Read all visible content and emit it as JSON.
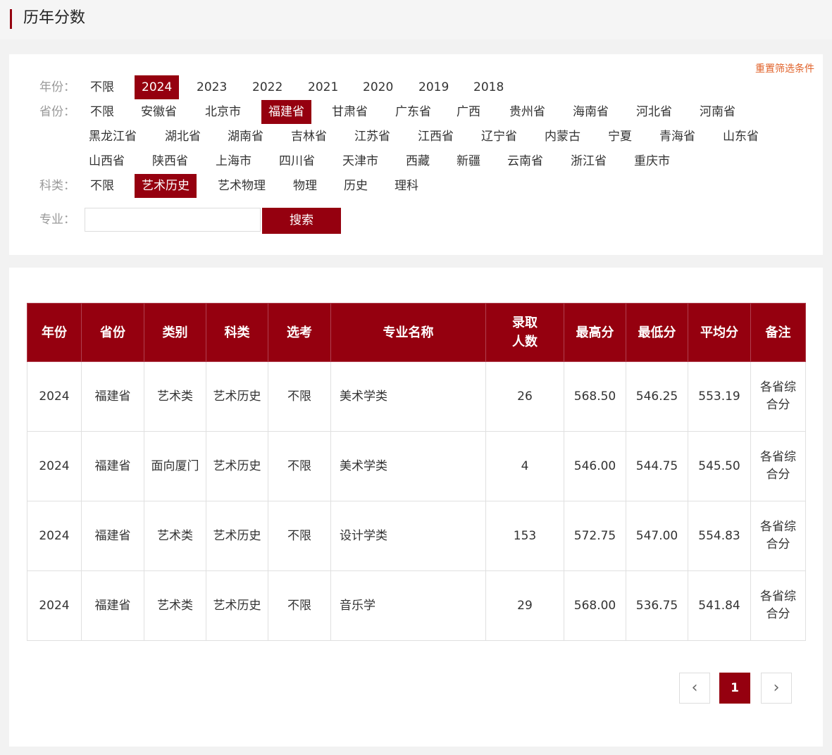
{
  "header": {
    "title": "历年分数"
  },
  "filters": {
    "reset_label": "重置筛选条件",
    "year": {
      "label": "年份：",
      "options": [
        "不限",
        "2024",
        "2023",
        "2022",
        "2021",
        "2020",
        "2019",
        "2018"
      ],
      "selected": "2024"
    },
    "province": {
      "label": "省份：",
      "rows": [
        [
          "不限",
          "安徽省",
          "北京市",
          "福建省",
          "甘肃省",
          "广东省",
          "广西",
          "贵州省",
          "海南省",
          "河北省",
          "河南省"
        ],
        [
          "黑龙江省",
          "湖北省",
          "湖南省",
          "吉林省",
          "江苏省",
          "江西省",
          "辽宁省",
          "内蒙古",
          "宁夏",
          "青海省",
          "山东省"
        ],
        [
          "山西省",
          "陕西省",
          "上海市",
          "四川省",
          "天津市",
          "西藏",
          "新疆",
          "云南省",
          "浙江省",
          "重庆市"
        ]
      ],
      "selected": "福建省"
    },
    "subject": {
      "label": "科类：",
      "options": [
        "不限",
        "艺术历史",
        "艺术物理",
        "物理",
        "历史",
        "理科"
      ],
      "selected": "艺术历史"
    },
    "major": {
      "label": "专业：",
      "value": "",
      "search_label": "搜索"
    }
  },
  "table": {
    "headers": [
      "年份",
      "省份",
      "类别",
      "科类",
      "选考",
      "专业名称",
      "录取\n人数",
      "最高分",
      "最低分",
      "平均分",
      "备注"
    ],
    "rows": [
      [
        "2024",
        "福建省",
        "艺术类",
        "艺术历史",
        "不限",
        "美术学类",
        "26",
        "568.50",
        "546.25",
        "553.19",
        "各省综合分"
      ],
      [
        "2024",
        "福建省",
        "面向厦门",
        "艺术历史",
        "不限",
        "美术学类",
        "4",
        "546.00",
        "544.75",
        "545.50",
        "各省综合分"
      ],
      [
        "2024",
        "福建省",
        "艺术类",
        "艺术历史",
        "不限",
        "设计学类",
        "153",
        "572.75",
        "547.00",
        "554.83",
        "各省综合分"
      ],
      [
        "2024",
        "福建省",
        "艺术类",
        "艺术历史",
        "不限",
        "音乐学",
        "29",
        "568.00",
        "536.75",
        "541.84",
        "各省综合分"
      ]
    ]
  },
  "pagination": {
    "prev": "‹",
    "current": "1",
    "next": "›"
  },
  "colors": {
    "accent": "#95000f",
    "reset_link": "#e0622a"
  }
}
